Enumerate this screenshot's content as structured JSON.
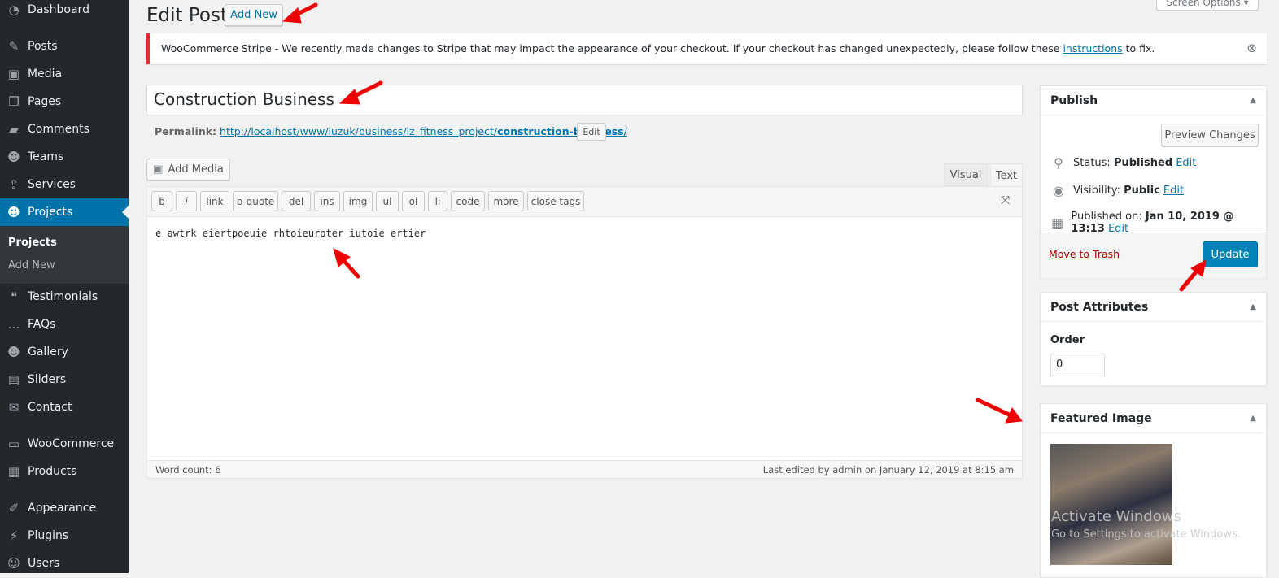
{
  "sidebar": {
    "items": [
      {
        "label": "Dashboard",
        "icon": "dashboard-icon",
        "glyph": "◔"
      },
      {
        "label": "Posts",
        "icon": "pin-icon",
        "glyph": "✎"
      },
      {
        "label": "Media",
        "icon": "media-icon",
        "glyph": "▣"
      },
      {
        "label": "Pages",
        "icon": "pages-icon",
        "glyph": "❐"
      },
      {
        "label": "Comments",
        "icon": "comment-icon",
        "glyph": "▰"
      },
      {
        "label": "Teams",
        "icon": "groups-icon",
        "glyph": "☻"
      },
      {
        "label": "Services",
        "icon": "share-icon",
        "glyph": "⇪"
      },
      {
        "label": "Projects",
        "icon": "groups-icon",
        "glyph": "☻"
      },
      {
        "label": "Testimonials",
        "icon": "testimonial-icon",
        "glyph": "❝"
      },
      {
        "label": "FAQs",
        "icon": "faq-icon",
        "glyph": "…"
      },
      {
        "label": "Gallery",
        "icon": "gallery-icon",
        "glyph": "☻"
      },
      {
        "label": "Sliders",
        "icon": "slides-icon",
        "glyph": "▤"
      },
      {
        "label": "Contact",
        "icon": "email-icon",
        "glyph": "✉"
      },
      {
        "label": "WooCommerce",
        "icon": "woo-icon",
        "glyph": "▭"
      },
      {
        "label": "Products",
        "icon": "archive-icon",
        "glyph": "▦"
      },
      {
        "label": "Appearance",
        "icon": "brush-icon",
        "glyph": "✐"
      },
      {
        "label": "Plugins",
        "icon": "plugin-icon",
        "glyph": "⚡"
      },
      {
        "label": "Users",
        "icon": "users-icon",
        "glyph": "☺"
      }
    ],
    "submenu": [
      "Projects",
      "Add New"
    ]
  },
  "header": {
    "title": "Edit Post",
    "add_new": "Add New",
    "screen_options": "Screen Options ▾"
  },
  "notice": {
    "text": "WooCommerce Stripe - We recently made changes to Stripe that may impact the appearance of your checkout. If your checkout has changed unexpectedly, please follow these ",
    "link": "instructions",
    "after": " to fix.",
    "accent": "#dc3232"
  },
  "post": {
    "title": "Construction Business",
    "permalink_label": "Permalink:",
    "permalink_base": "http://localhost/www/luzuk/business/lz_fitness_project/",
    "permalink_slug": "construction-business",
    "permalink_end": "/",
    "edit": "Edit"
  },
  "editor": {
    "add_media": "Add Media",
    "tabs": [
      "Visual",
      "Text"
    ],
    "quicktags": [
      "b",
      "i",
      "link",
      "b-quote",
      "del",
      "ins",
      "img",
      "ul",
      "ol",
      "li",
      "code",
      "more",
      "close tags"
    ],
    "content": "e awtrk eiertpoeuie rhtoieuroter iutoie ertier",
    "word_count": "Word count: 6",
    "last_edited": "Last edited by admin on January 12, 2019 at 8:15 am"
  },
  "publish": {
    "title": "Publish",
    "preview": "Preview Changes",
    "status_label": "Status:",
    "status": "Published",
    "visibility_label": "Visibility:",
    "visibility": "Public",
    "published_label": "Published on:",
    "published": "Jan 10, 2019 @ 13:13",
    "edit": "Edit",
    "trash": "Move to Trash",
    "update": "Update",
    "accent": "#0085ba"
  },
  "attributes": {
    "title": "Post Attributes",
    "order_label": "Order",
    "order": "0"
  },
  "featured": {
    "title": "Featured Image"
  },
  "watermark": {
    "line1": "Activate Windows",
    "line2": "Go to Settings to activate Windows."
  }
}
